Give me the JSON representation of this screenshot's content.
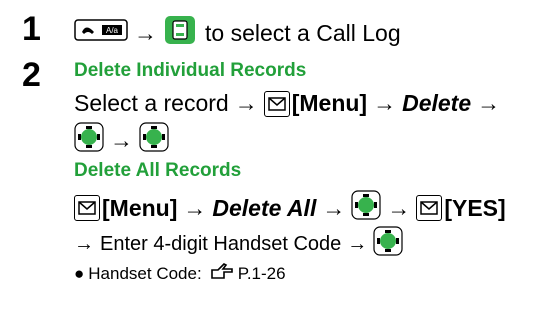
{
  "step1": {
    "number": "1",
    "text": "to select a Call Log"
  },
  "step2": {
    "number": "2",
    "heading_individual": "Delete Individual Records",
    "select_record": "Select a record",
    "menu": "[Menu]",
    "delete": "Delete",
    "heading_all": "Delete All Records",
    "delete_all": "Delete All",
    "yes": "[YES]",
    "enter_code": "Enter 4-digit Handset Code"
  },
  "note": {
    "bullet": "●",
    "label": "Handset Code:",
    "ref": "P.1-26"
  },
  "arrow": "→",
  "colors": {
    "heading": "#22a03a",
    "key_fill": "#37b24d"
  }
}
